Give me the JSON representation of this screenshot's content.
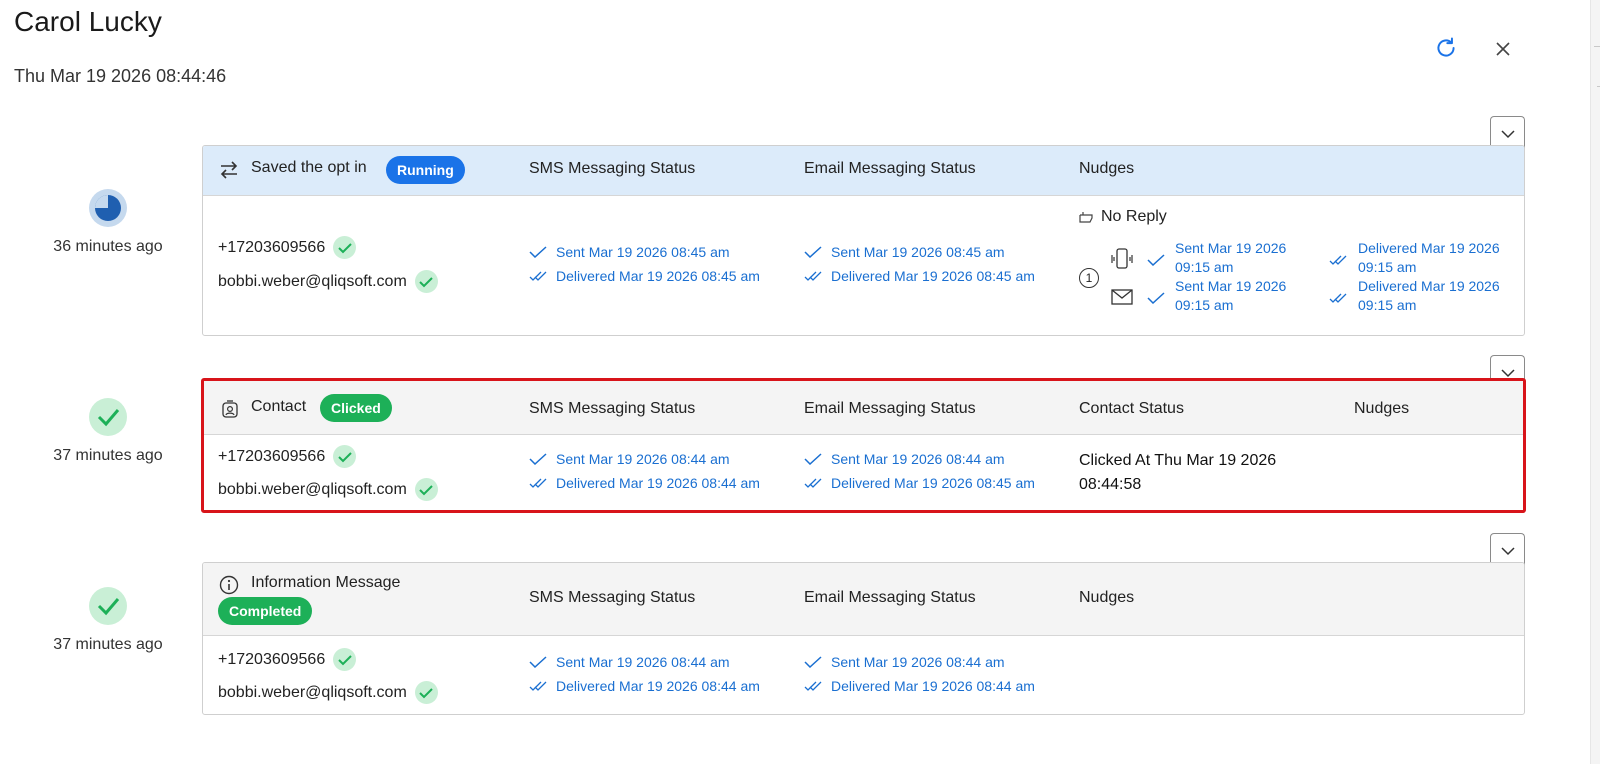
{
  "header": {
    "title": "Carol Lucky",
    "datetime": "Thu Mar 19 2026 08:44:46",
    "refresh_icon": "refresh-icon",
    "close_icon": "close-icon"
  },
  "columns": {
    "sms": "SMS Messaging Status",
    "email": "Email Messaging Status",
    "nudges": "Nudges",
    "contact_status": "Contact Status"
  },
  "steps": [
    {
      "time": "36 minutes ago",
      "state_icon": "progress-pie-icon",
      "type_icon": "swap-arrows-icon",
      "name": "Saved the opt in",
      "badge": "Running",
      "phone": "+17203609566",
      "email": "bobbi.weber@qliqsoft.com",
      "sms_sent": "Sent Mar 19 2026 08:45 am",
      "sms_delivered": "Delivered Mar 19 2026 08:45 am",
      "email_sent": "Sent Mar 19 2026 08:45 am",
      "email_delivered": "Delivered Mar 19 2026 08:45 am",
      "nudges": {
        "label": "No Reply",
        "number": "1",
        "sms_sent": "Sent Mar 19 2026 09:15 am",
        "sms_delivered": "Delivered Mar 19 2026 09:15 am",
        "email_sent": "Sent Mar 19 2026 09:15 am",
        "email_delivered": "Delivered Mar 19 2026 09:15 am"
      }
    },
    {
      "time": "37 minutes ago",
      "state_icon": "check-circle-icon",
      "type_icon": "contact-card-icon",
      "name": "Contact",
      "badge": "Clicked",
      "phone": "+17203609566",
      "email": "bobbi.weber@qliqsoft.com",
      "sms_sent": "Sent Mar 19 2026 08:44 am",
      "sms_delivered": "Delivered Mar 19 2026 08:44 am",
      "email_sent": "Sent Mar 19 2026 08:44 am",
      "email_delivered": "Delivered Mar 19 2026 08:45 am",
      "contact_status": "Clicked At Thu Mar 19 2026 08:44:58"
    },
    {
      "time": "37 minutes ago",
      "state_icon": "check-circle-icon",
      "type_icon": "info-icon",
      "name": "Information Message",
      "badge": "Completed",
      "phone": "+17203609566",
      "email": "bobbi.weber@qliqsoft.com",
      "sms_sent": "Sent Mar 19 2026 08:44 am",
      "sms_delivered": "Delivered Mar 19 2026 08:44 am",
      "email_sent": "Sent Mar 19 2026 08:44 am",
      "email_delivered": "Delivered Mar 19 2026 08:44 am"
    }
  ],
  "colors": {
    "accent": "#1a73e8",
    "success": "#1db058",
    "link": "#1a6fd1",
    "highlight": "#d8141a",
    "header_blue": "#dcebfa"
  }
}
